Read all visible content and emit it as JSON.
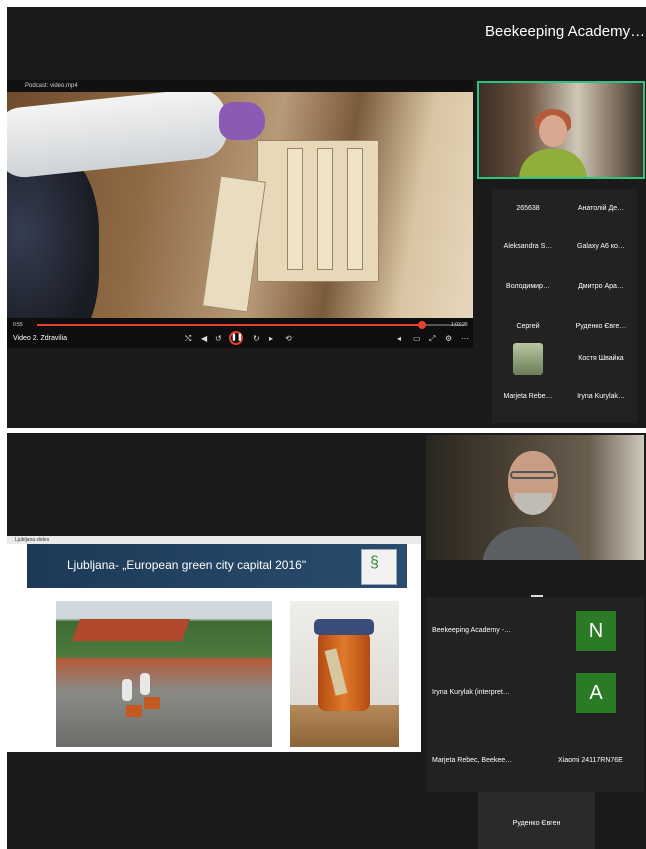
{
  "top": {
    "conference_title": "Beekeeping Academy…",
    "video": {
      "window_title": "Podcast: video.mp4",
      "title": "Video 2. Zdravilia",
      "time_elapsed": "0:55",
      "time_total": "1:03:26",
      "progress": 0.9
    },
    "participants": [
      {
        "name": "265638"
      },
      {
        "name": "Анатолій Де…"
      },
      {
        "name": "Aleksandra S…"
      },
      {
        "name": "Galaxy A6 ко…"
      },
      {
        "name": "Володимир…"
      },
      {
        "name": "Дмитро Ара…"
      },
      {
        "name": "Сергей"
      },
      {
        "name": "Руденко Євге…"
      },
      {
        "name": ""
      },
      {
        "name": "Костя Швайка"
      },
      {
        "name": "Marjeta Rebe…"
      },
      {
        "name": "Iryna Kurylak…"
      }
    ]
  },
  "bottom": {
    "share_title": "Ljubljana slides",
    "slide_title": "Ljubljana- „European green city capital 2016\"",
    "grid": {
      "row1_name": "Beekeeping Academy -…",
      "row1_initial": "N",
      "row2_name": "Iryna Kurylak (interpret…",
      "row2_initial": "A",
      "row3_left": "Marjeta Rebec, Beekee…",
      "row3_right": "Xiaomi 24117RN76E"
    },
    "bottom_tile_name": "Руденко Євген"
  },
  "colors": {
    "active_border": "#2ec27e",
    "progress": "#e5402f",
    "initial_bg": "#2a7a26"
  }
}
